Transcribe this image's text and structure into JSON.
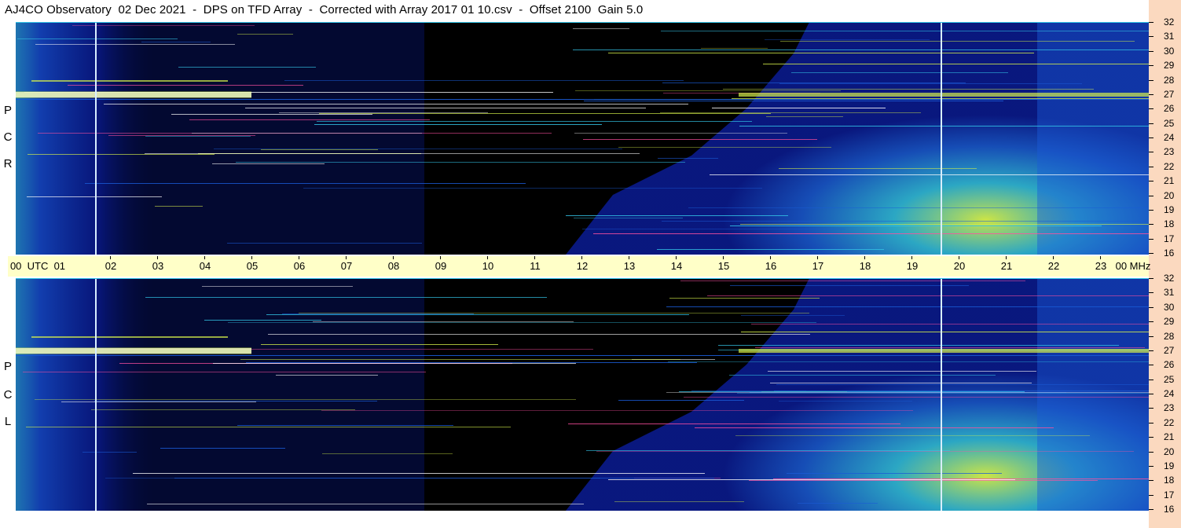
{
  "header": {
    "title": "AJ4CO Observatory  02 Dec 2021  -  DPS on TFD Array  -  Corrected with Array 2017 01 10.csv  -  Offset 2100  Gain 5.0"
  },
  "panels": [
    {
      "id": "rcp",
      "letters": [
        "R",
        "C",
        "P"
      ]
    },
    {
      "id": "lcp",
      "letters": [
        "L",
        "C",
        "P"
      ]
    }
  ],
  "time_axis": {
    "labels": [
      "00  UTC  01",
      "02",
      "03",
      "04",
      "05",
      "06",
      "07",
      "08",
      "09",
      "10",
      "11",
      "12",
      "13",
      "14",
      "15",
      "16",
      "17",
      "18",
      "19",
      "20",
      "21",
      "22",
      "23",
      "00 MHz"
    ]
  },
  "freq_axis": {
    "labels": [
      "32",
      "31",
      "30",
      "29",
      "28",
      "27",
      "26",
      "25",
      "24",
      "23",
      "22",
      "21",
      "20",
      "19",
      "18",
      "17",
      "16"
    ]
  },
  "colors": {
    "background": "#000000",
    "deep_blue": "#0a1a8c",
    "blue": "#1a5bd6",
    "cyan": "#33c4e6",
    "green_yellow": "#d6f04a",
    "time_bar": "#ffffc8",
    "freq_strip": "#fbd9bf"
  }
}
